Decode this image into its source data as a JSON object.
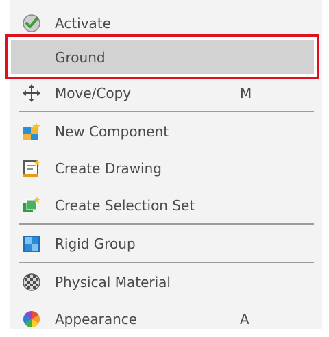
{
  "menu": {
    "items": [
      {
        "label": "Activate",
        "shortcut": "",
        "icon": "activate-check-icon"
      },
      {
        "label": "Ground",
        "shortcut": "",
        "icon": ""
      },
      {
        "label": "Move/Copy",
        "shortcut": "M",
        "icon": "move-arrows-icon"
      },
      {
        "label": "New Component",
        "shortcut": "",
        "icon": "new-component-icon"
      },
      {
        "label": "Create Drawing",
        "shortcut": "",
        "icon": "create-drawing-icon"
      },
      {
        "label": "Create Selection Set",
        "shortcut": "",
        "icon": "selection-set-icon"
      },
      {
        "label": "Rigid Group",
        "shortcut": "",
        "icon": "rigid-group-icon"
      },
      {
        "label": "Physical Material",
        "shortcut": "",
        "icon": "physical-material-icon"
      },
      {
        "label": "Appearance",
        "shortcut": "A",
        "icon": "appearance-icon"
      }
    ]
  },
  "colors": {
    "highlight_border": "#e0101d",
    "hover_fill": "#d2d2d2",
    "menu_background": "#f3f3f3"
  }
}
